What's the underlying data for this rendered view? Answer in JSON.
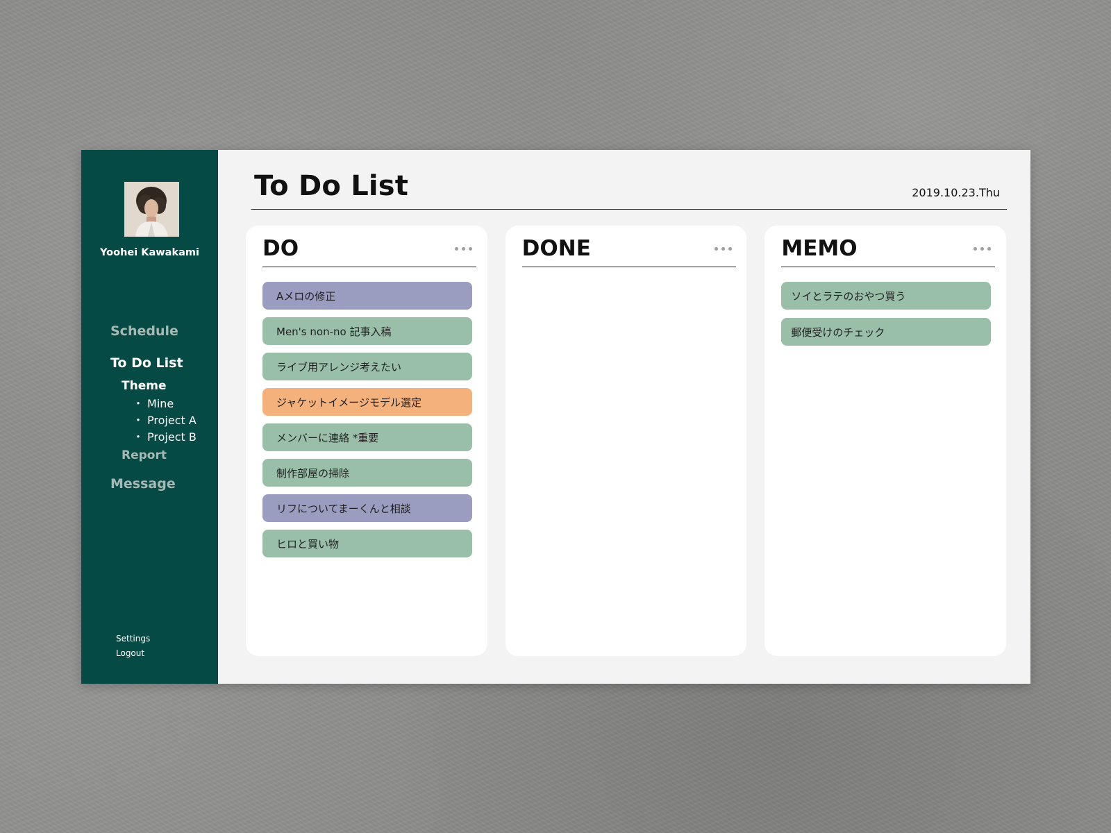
{
  "user": {
    "name": "Yoohei Kawakami"
  },
  "sidebar": {
    "nav": {
      "schedule": "Schedule",
      "todo": "To Do List",
      "theme": "Theme",
      "projects": [
        {
          "bullet": "・",
          "label": "Mine"
        },
        {
          "bullet": "・",
          "label": "Project A"
        },
        {
          "bullet": "・",
          "label": "Project B"
        }
      ],
      "report": "Report",
      "message": "Message"
    },
    "bottom": {
      "settings": "Settings",
      "logout": "Logout"
    }
  },
  "header": {
    "title": "To Do List",
    "date": "2019.10.23.Thu"
  },
  "columns": [
    {
      "title": "DO",
      "items": [
        {
          "label": "Aメロの修正",
          "color": "#9a9cc0"
        },
        {
          "label": "Men's non-no 記事入稿",
          "color": "#99bfa8"
        },
        {
          "label": "ライブ用アレンジ考えたい",
          "color": "#99bfa8"
        },
        {
          "label": "ジャケットイメージモデル選定",
          "color": "#f4b17c"
        },
        {
          "label": "メンバーに連絡 *重要",
          "color": "#99bfa8"
        },
        {
          "label": "制作部屋の掃除",
          "color": "#99bfa8"
        },
        {
          "label": "リフについてまーくんと相談",
          "color": "#9a9cc0"
        },
        {
          "label": "ヒロと買い物",
          "color": "#99bfa8"
        }
      ]
    },
    {
      "title": "DONE",
      "items": []
    },
    {
      "title": "MEMO",
      "items": [
        {
          "label": "ソイとラテのおやつ買う",
          "color": "#99bfa8"
        },
        {
          "label": "郵便受けのチェック",
          "color": "#99bfa8"
        }
      ]
    }
  ],
  "icons": {
    "more": "more-icon"
  },
  "colors": {
    "sidebar": "#064a45",
    "main_bg": "#f3f3f3",
    "card_bg": "#ffffff",
    "task_purple": "#9a9cc0",
    "task_green": "#99bfa8",
    "task_orange": "#f4b17c"
  }
}
